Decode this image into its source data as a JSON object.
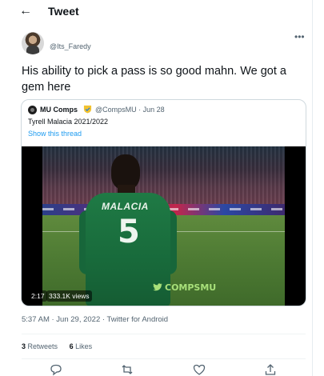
{
  "header": {
    "title": "Tweet",
    "back_icon": "arrow-left-icon"
  },
  "tweet": {
    "handle": "@Its_Faredy",
    "text": "His ability to pick a pass is so good mahn. We got a gem here",
    "timestamp": "5:37 AM · Jun 29, 2022 · Twitter for Android",
    "retweets_count": "3",
    "retweets_label": "Retweets",
    "likes_count": "6",
    "likes_label": "Likes"
  },
  "quoted": {
    "name": "MU Comps",
    "meta": "@CompsMU · Jun 28",
    "text": "Tyrell Malacia 2021/2022",
    "thread_link": "Show this thread",
    "video": {
      "duration": "2:17",
      "views": "333.1K views",
      "watermark": "COMPSMU",
      "shirt_name": "MALACIA",
      "shirt_number": "5"
    }
  },
  "icons": {
    "reply": "reply-icon",
    "retweet": "retweet-icon",
    "like": "heart-icon",
    "share": "share-icon",
    "more": "more-icon",
    "verified": "verified-badge-icon"
  },
  "colors": {
    "link": "#1d9bf0",
    "secondary_text": "#536471",
    "border": "#cfd9de"
  }
}
